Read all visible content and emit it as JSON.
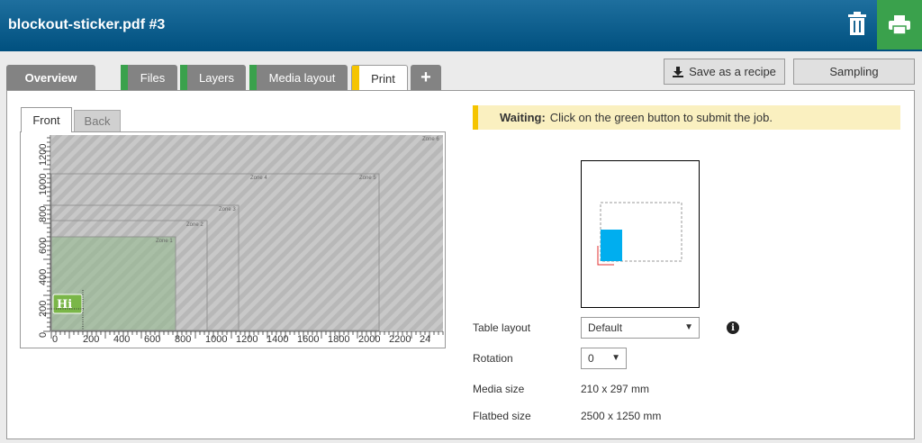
{
  "header": {
    "title": "blockout-sticker.pdf #3"
  },
  "tabs": [
    {
      "label": "Overview"
    },
    {
      "label": "Files",
      "status_color": "#3aa14c"
    },
    {
      "label": "Layers",
      "status_color": "#3aa14c"
    },
    {
      "label": "Media layout",
      "status_color": "#3aa14c"
    },
    {
      "label": "Print",
      "status_color": "#f5c400"
    },
    {
      "label": "+"
    }
  ],
  "toolbar": {
    "save_recipe_label": "Save as a recipe",
    "sampling_label": "Sampling"
  },
  "preview": {
    "front_label": "Front",
    "back_label": "Back",
    "zones": [
      "Zone 1",
      "Zone 2",
      "Zone 3",
      "Zone 4",
      "Zone 5",
      "Zone 6"
    ],
    "x_ticks": [
      "0",
      "200",
      "400",
      "600",
      "800",
      "1000",
      "1200",
      "1400",
      "1600",
      "1800",
      "2000",
      "2200",
      "24"
    ],
    "y_ticks": [
      "0",
      "200",
      "400",
      "600",
      "800",
      "1000",
      "1200"
    ],
    "sticker_text": "Hi"
  },
  "status": {
    "title": "Waiting:",
    "message": "Click on the green button to submit the job."
  },
  "settings": {
    "table_layout_label": "Table layout",
    "table_layout_value": "Default",
    "rotation_label": "Rotation",
    "rotation_value": "0",
    "media_size_label": "Media size",
    "media_size_value": "210 x 297 mm",
    "flatbed_size_label": "Flatbed size",
    "flatbed_size_value": "2500 x 1250 mm"
  },
  "colors": {
    "header": "#00507f",
    "print_button": "#3aa14c",
    "waiting_bg": "#faf0c0",
    "media_blue": "#00aeef"
  }
}
